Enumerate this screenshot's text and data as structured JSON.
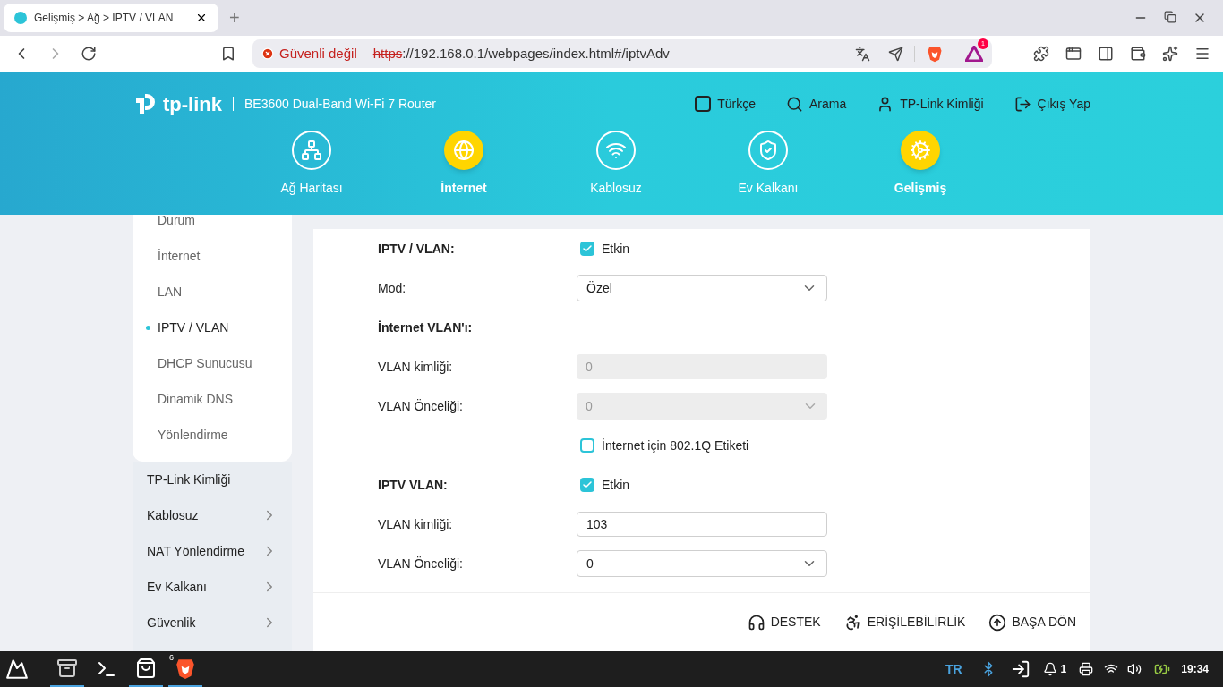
{
  "browser": {
    "tab": {
      "title": "Gelişmiş > Ağ > IPTV / VLAN"
    },
    "new_tab": "+",
    "security": "Güvenli değil",
    "url_scheme": "https",
    "url_rest": "://192.168.0.1/webpages/index.html#/iptvAdv",
    "badge": "1"
  },
  "header": {
    "brand": "tp-link",
    "model": "BE3600 Dual-Band Wi-Fi 7 Router",
    "links": [
      {
        "kind": "language",
        "label": "Türkçe"
      },
      {
        "kind": "search",
        "label": "Arama"
      },
      {
        "kind": "account",
        "label": "TP-Link Kimliği"
      },
      {
        "kind": "logout",
        "label": "Çıkış Yap"
      }
    ],
    "nav": [
      {
        "kind": "map",
        "label": "Ağ Haritası",
        "selected": false
      },
      {
        "kind": "globe",
        "label": "İnternet",
        "selected": true
      },
      {
        "kind": "wifi",
        "label": "Kablosuz",
        "selected": false
      },
      {
        "kind": "shield",
        "label": "Ev Kalkanı",
        "selected": false
      },
      {
        "kind": "gear",
        "label": "Gelişmiş",
        "selected": true
      }
    ]
  },
  "sidebar": {
    "submenu": [
      {
        "label": "Durum",
        "selected": false
      },
      {
        "label": "İnternet",
        "selected": false
      },
      {
        "label": "LAN",
        "selected": false
      },
      {
        "label": "IPTV / VLAN",
        "selected": true
      },
      {
        "label": "DHCP Sunucusu",
        "selected": false
      },
      {
        "label": "Dinamik DNS",
        "selected": false
      },
      {
        "label": "Yönlendirme",
        "selected": false
      }
    ],
    "items": [
      {
        "label": "TP-Link Kimliği",
        "expandable": false
      },
      {
        "label": "Kablosuz",
        "expandable": true
      },
      {
        "label": "NAT Yönlendirme",
        "expandable": true
      },
      {
        "label": "Ev Kalkanı",
        "expandable": true
      },
      {
        "label": "Güvenlik",
        "expandable": true
      }
    ]
  },
  "form": [
    {
      "kind": "checkbox",
      "label": "IPTV / VLAN:",
      "option": "Etkin",
      "checked": true
    },
    {
      "kind": "select",
      "label": "Mod:",
      "value": "Özel",
      "disabled": false
    },
    {
      "kind": "heading",
      "label": "İnternet VLAN'ı:"
    },
    {
      "kind": "input",
      "label": "VLAN kimliği:",
      "value": "0",
      "disabled": true
    },
    {
      "kind": "select",
      "label": "VLAN Önceliği:",
      "value": "0",
      "disabled": true
    },
    {
      "kind": "checkbox",
      "option": "İnternet için 802.1Q Etiketi",
      "checked": false
    },
    {
      "kind": "checkbox",
      "label": "IPTV VLAN:",
      "option": "Etkin",
      "checked": true
    },
    {
      "kind": "input",
      "label": "VLAN kimliği:",
      "value": "103",
      "disabled": false
    },
    {
      "kind": "select",
      "label": "VLAN Önceliği:",
      "value": "0",
      "disabled": false
    }
  ],
  "footer": [
    {
      "kind": "support",
      "label": "DESTEK"
    },
    {
      "kind": "accessibility",
      "label": "ERİŞİLEBİLİRLİK"
    },
    {
      "kind": "top",
      "label": "BAŞA DÖN"
    }
  ],
  "taskbar": {
    "apps": [
      {
        "kind": "files",
        "active": true
      },
      {
        "kind": "terminal",
        "active": false
      },
      {
        "kind": "store",
        "active": true
      },
      {
        "kind": "brave",
        "active": true,
        "count": "6"
      }
    ],
    "keyboard": "TR",
    "notifications": "1",
    "clock": "19:34"
  }
}
